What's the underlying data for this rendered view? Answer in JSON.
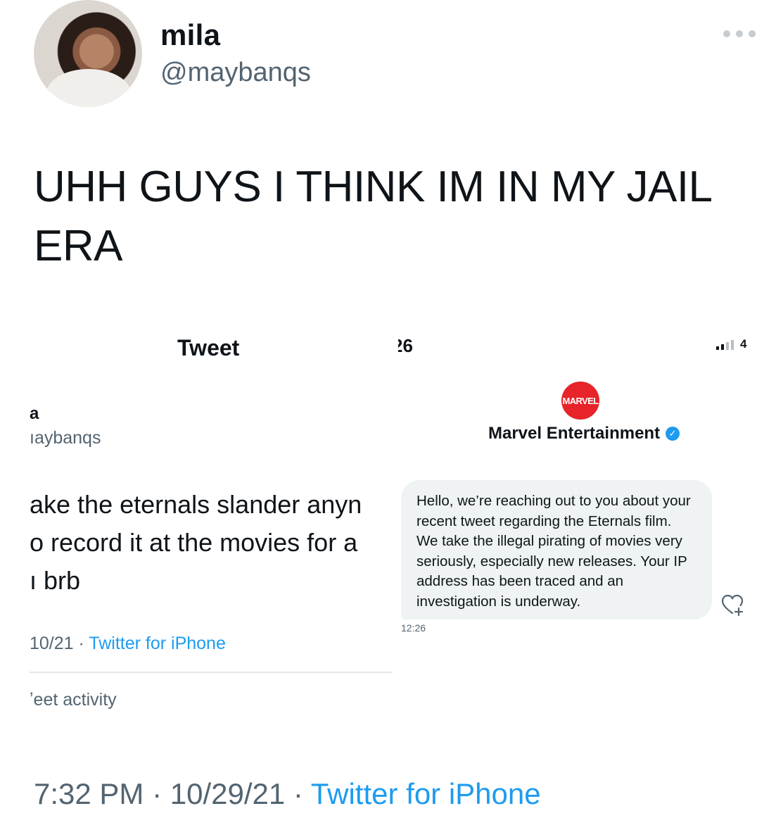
{
  "author": {
    "display_name": "mila",
    "handle": "@maybanqs"
  },
  "tweet": {
    "text_line1": "UHH GUYS I THINK IM IN MY JAIL",
    "text_line2": "ERA"
  },
  "media": {
    "left": {
      "title": "Tweet",
      "name": "a",
      "handle": "ıaybanqs",
      "text_lines": [
        "ake the eternals slander anyn",
        "o record it at the movies for a",
        "ı brb"
      ],
      "meta_date": "10/21 · ",
      "meta_source": "Twitter for iPhone",
      "activity": "ʼeet activity"
    },
    "right": {
      "status_time": "26",
      "carrier": "4",
      "logo_text": "MARVEL",
      "account_name": "Marvel Entertainment",
      "message": "Hello, we’re reaching out to you about your recent tweet regarding the Eternals film. We take the illegal pirating of movies very seriously, especially new releases. Your IP address has been traced and an investigation is underway.",
      "message_time": "12:26"
    }
  },
  "footer": {
    "time_date": "7:32 PM · 10/29/21 · ",
    "source": "Twitter for iPhone"
  },
  "colors": {
    "text": "#0f1419",
    "secondary": "#536471",
    "link": "#1d9bf0",
    "bubble": "#eff3f4",
    "marvel_red": "#e62429"
  }
}
